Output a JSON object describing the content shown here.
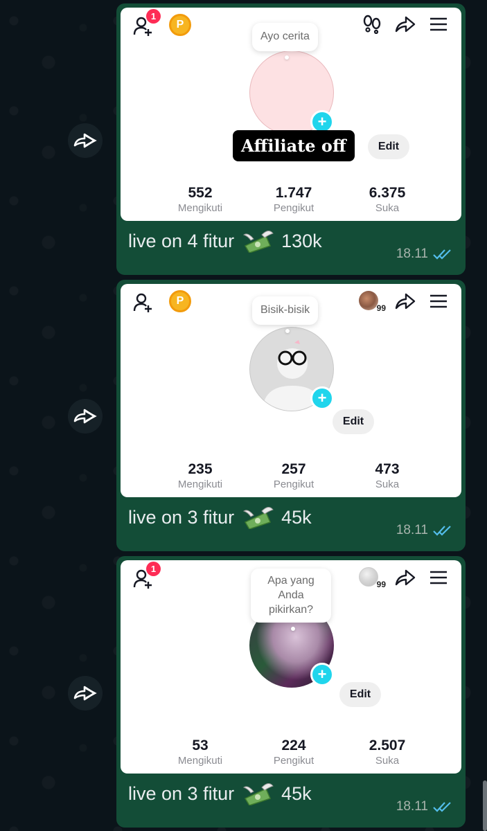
{
  "messages": [
    {
      "profile": {
        "follow_badge": "1",
        "p_badge": "P",
        "show_avatar99": false,
        "thought": "Ayo cerita",
        "avatar_style": "pink",
        "affiliate": "Affiliate off",
        "edit": "Edit",
        "stats": [
          {
            "value": "552",
            "label": "Mengikuti"
          },
          {
            "value": "1.747",
            "label": "Pengikut"
          },
          {
            "value": "6.375",
            "label": "Suka"
          }
        ]
      },
      "caption_pre": "live on 4 fitur",
      "caption_post": "130k",
      "time": "18.11"
    },
    {
      "profile": {
        "follow_badge": "",
        "p_badge": "P",
        "show_avatar99": true,
        "avatar99_num": "99",
        "thought": "Bisik-bisik",
        "avatar_style": "default",
        "affiliate": "",
        "edit": "Edit",
        "stats": [
          {
            "value": "235",
            "label": "Mengikuti"
          },
          {
            "value": "257",
            "label": "Pengikut"
          },
          {
            "value": "473",
            "label": "Suka"
          }
        ]
      },
      "caption_pre": "live on 3 fitur",
      "caption_post": "45k",
      "time": "18.11"
    },
    {
      "profile": {
        "follow_badge": "1",
        "p_badge": "",
        "show_avatar99": true,
        "avatar99_num": "99",
        "thought": "Apa yang Anda pikirkan?",
        "avatar_style": "photo",
        "affiliate": "",
        "edit": "Edit",
        "stats": [
          {
            "value": "53",
            "label": "Mengikuti"
          },
          {
            "value": "224",
            "label": "Pengikut"
          },
          {
            "value": "2.507",
            "label": "Suka"
          }
        ]
      },
      "caption_pre": "live on 3 fitur",
      "caption_post": "45k",
      "time": "18.11"
    }
  ],
  "colors": {
    "bubble": "#134d37",
    "tick": "#53bdeb",
    "plus": "#20d5ec",
    "badge": "#fe2c55"
  },
  "icons": [
    "forward-icon",
    "person-add-icon",
    "footprint-icon",
    "share-icon",
    "menu-icon",
    "money-with-wings-icon",
    "double-check-icon",
    "plus-icon"
  ]
}
